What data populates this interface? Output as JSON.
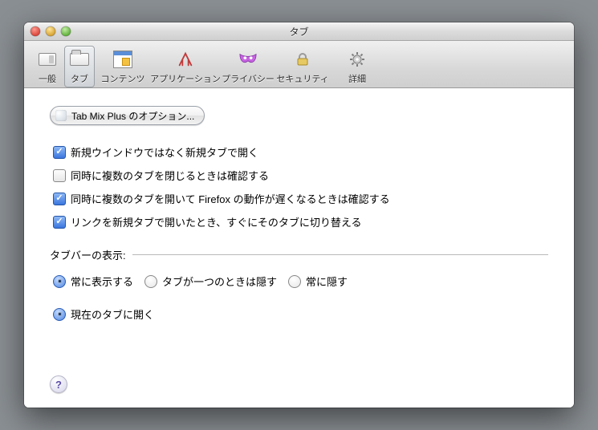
{
  "window": {
    "title": "タブ"
  },
  "toolbar": {
    "general": "一般",
    "tabs": "タブ",
    "content": "コンテンツ",
    "apps": "アプリケーション",
    "privacy": "プライバシー",
    "security": "セキュリティ",
    "advanced": "詳細",
    "active": "tabs"
  },
  "options_button": "Tab Mix Plus のオプション...",
  "checks": [
    {
      "label": "新規ウインドウではなく新規タブで開く",
      "checked": true
    },
    {
      "label": "同時に複数のタブを閉じるときは確認する",
      "checked": false
    },
    {
      "label": "同時に複数のタブを開いて Firefox の動作が遅くなるときは確認する",
      "checked": true
    },
    {
      "label": "リンクを新規タブで開いたとき、すぐにそのタブに切り替える",
      "checked": true
    }
  ],
  "tabbar_section": {
    "label": "タブバーの表示:"
  },
  "tabbar_options": [
    {
      "label": "常に表示する",
      "selected": true
    },
    {
      "label": "タブが一つのときは隠す",
      "selected": false
    },
    {
      "label": "常に隠す",
      "selected": false
    }
  ],
  "open_in_current": {
    "label": "現在のタブに開く",
    "selected": true
  },
  "help": "?"
}
